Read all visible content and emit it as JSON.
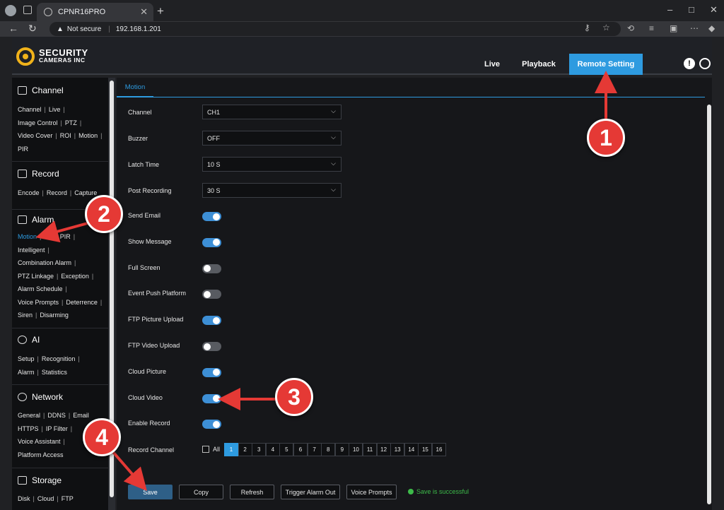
{
  "browser": {
    "tab_title": "CPNR16PRO",
    "new_tab": "+",
    "security_label": "Not secure",
    "url": "192.168.1.201",
    "window_controls": [
      "–",
      "□",
      "✕"
    ]
  },
  "header": {
    "logo_line1": "SECURITY",
    "logo_line2": "CAMERAS INC",
    "nav": [
      "Live",
      "Playback",
      "Remote Setting"
    ],
    "active_nav": "Remote Setting"
  },
  "sidebar": {
    "sections": [
      {
        "title": "Channel",
        "icon": "camera-icon",
        "links": [
          "Channel",
          "Live",
          "PTZ",
          "Image Control",
          "PTZ",
          "Video Cover",
          "ROI",
          "Motion",
          "PIR"
        ]
      },
      {
        "title": "Record",
        "icon": "record-icon",
        "links": [
          "Encode",
          "Record",
          "Capture"
        ]
      },
      {
        "title": "Alarm",
        "icon": "alarm-icon",
        "links": [
          "Motion",
          "I/O",
          "PIR",
          "Intelligent",
          "Combination Alarm",
          "PTZ Linkage",
          "Exception",
          "Alarm Schedule",
          "Voice Prompts",
          "Deterrence",
          "Siren",
          "Disarming"
        ]
      },
      {
        "title": "AI",
        "icon": "ai-icon",
        "links": [
          "Setup",
          "Recognition",
          "Alarm",
          "Statistics"
        ]
      },
      {
        "title": "Network",
        "icon": "network-icon",
        "links": [
          "General",
          "DDNS",
          "Email",
          "HTTPS",
          "IP Filter",
          "Voice Assistant",
          "Platform Access"
        ]
      },
      {
        "title": "Storage",
        "icon": "storage-icon",
        "links": [
          "Disk",
          "Cloud",
          "FTP"
        ]
      }
    ],
    "active_link": "Motion"
  },
  "main": {
    "tab": "Motion",
    "fields": {
      "channel": {
        "label": "Channel",
        "value": "CH1"
      },
      "buzzer": {
        "label": "Buzzer",
        "value": "OFF"
      },
      "latch_time": {
        "label": "Latch Time",
        "value": "10 S"
      },
      "post_recording": {
        "label": "Post Recording",
        "value": "30 S"
      }
    },
    "toggles": [
      {
        "label": "Send Email",
        "on": true
      },
      {
        "label": "Show Message",
        "on": true
      },
      {
        "label": "Full Screen",
        "on": false
      },
      {
        "label": "Event Push Platform",
        "on": false
      },
      {
        "label": "FTP Picture Upload",
        "on": true
      },
      {
        "label": "FTP Video Upload",
        "on": false
      },
      {
        "label": "Cloud Picture",
        "on": true
      },
      {
        "label": "Cloud Video",
        "on": true
      },
      {
        "label": "Enable Record",
        "on": true
      }
    ],
    "record_channel": {
      "label": "Record Channel",
      "all_label": "All",
      "channels": [
        "1",
        "2",
        "3",
        "4",
        "5",
        "6",
        "7",
        "8",
        "9",
        "10",
        "11",
        "12",
        "13",
        "14",
        "15",
        "16"
      ],
      "selected": [
        "1"
      ]
    },
    "buttons": {
      "save": "Save",
      "copy": "Copy",
      "refresh": "Refresh",
      "trigger": "Trigger Alarm Out",
      "voice": "Voice Prompts"
    },
    "status": "Save is successful"
  },
  "callouts": [
    "1",
    "2",
    "3",
    "4"
  ],
  "colors": {
    "accent": "#2e9be0",
    "callout": "#e53935",
    "success": "#3dbb4a",
    "logo": "#f0b21a"
  }
}
